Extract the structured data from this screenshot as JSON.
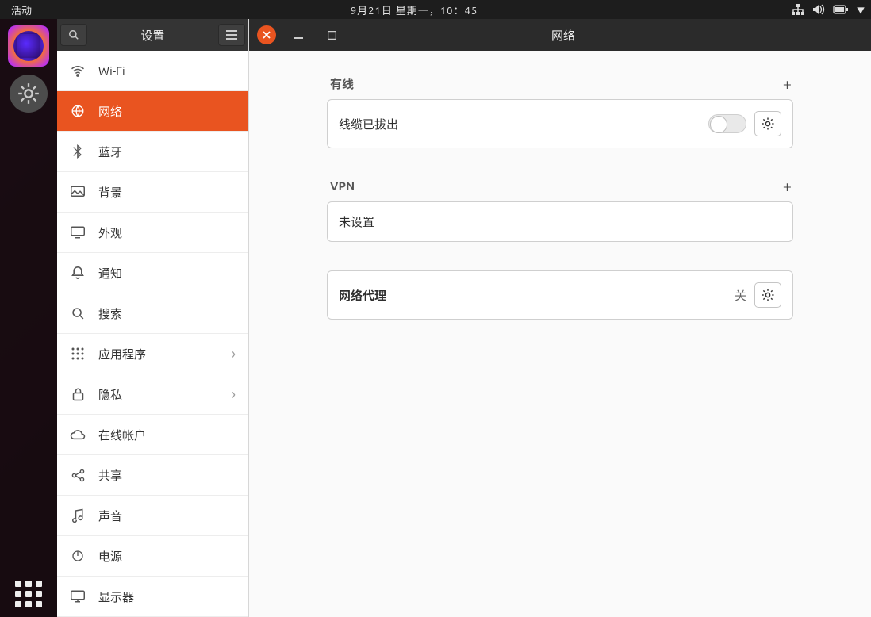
{
  "topbar": {
    "activities": "活动",
    "datetime": "9月21日 星期一，10：45"
  },
  "sidebar": {
    "title": "设置",
    "items": [
      {
        "icon": "wifi",
        "label": "Wi-Fi"
      },
      {
        "icon": "globe",
        "label": "网络",
        "active": true
      },
      {
        "icon": "bluetooth",
        "label": "蓝牙"
      },
      {
        "icon": "background",
        "label": "背景"
      },
      {
        "icon": "appearance",
        "label": "外观"
      },
      {
        "icon": "bell",
        "label": "通知"
      },
      {
        "icon": "search",
        "label": "搜索"
      },
      {
        "icon": "apps",
        "label": "应用程序",
        "chevron": true
      },
      {
        "icon": "lock",
        "label": "隐私",
        "chevron": true
      },
      {
        "icon": "cloud",
        "label": "在线帐户"
      },
      {
        "icon": "share",
        "label": "共享"
      },
      {
        "icon": "music",
        "label": "声音"
      },
      {
        "icon": "power",
        "label": "电源"
      },
      {
        "icon": "display",
        "label": "显示器"
      }
    ]
  },
  "header": {
    "title": "网络"
  },
  "sections": {
    "wired": {
      "heading": "有线",
      "status": "线缆已拔出"
    },
    "vpn": {
      "heading": "VPN",
      "status": "未设置"
    },
    "proxy": {
      "label": "网络代理",
      "status": "关"
    }
  }
}
